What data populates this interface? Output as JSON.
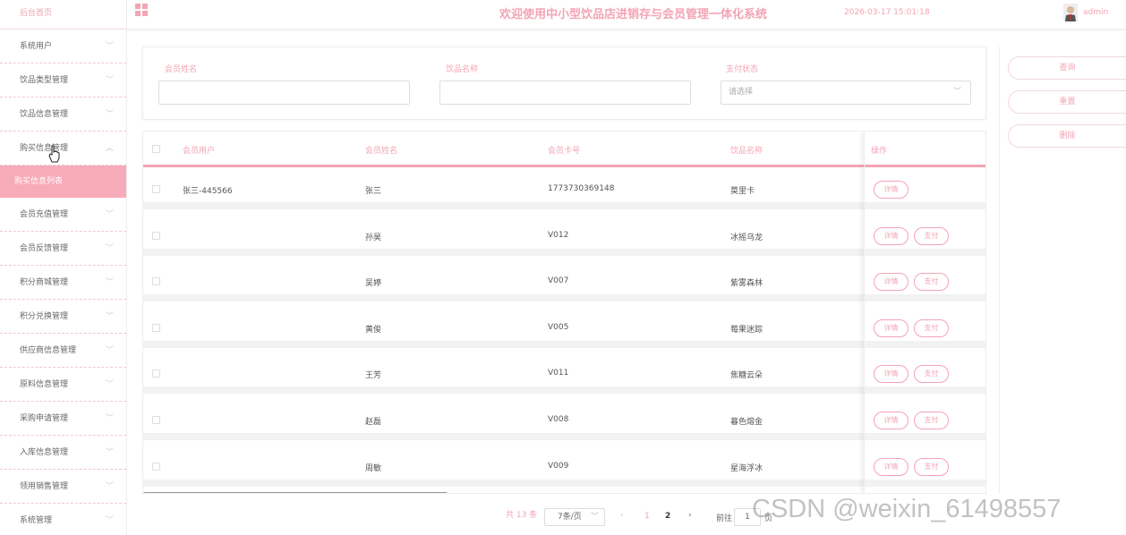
{
  "sidebar": {
    "home": "后台首页",
    "items": [
      {
        "label": "系统用户"
      },
      {
        "label": "饮品类型管理"
      },
      {
        "label": "饮品信息管理"
      },
      {
        "label": "购买信息管理"
      },
      {
        "label": "会员充值管理"
      },
      {
        "label": "会员反馈管理"
      },
      {
        "label": "积分商城管理"
      },
      {
        "label": "积分兑换管理"
      },
      {
        "label": "供应商信息管理"
      },
      {
        "label": "原料信息管理"
      },
      {
        "label": "采购申请管理"
      },
      {
        "label": "入库信息管理"
      },
      {
        "label": "领用销售管理"
      },
      {
        "label": "系统管理"
      }
    ],
    "sub_item": "购买信息列表"
  },
  "header": {
    "title": "欢迎使用中小型饮品店进销存与会员管理一体化系统",
    "time": "2026-03-17 15:01:18",
    "user": "admin"
  },
  "search": {
    "member_name_label": "会员姓名",
    "drink_name_label": "饮品名称",
    "pay_status_label": "支付状态",
    "pay_status_placeholder": "请选择"
  },
  "actions": {
    "query": "查询",
    "reset": "重置",
    "delete": "删除"
  },
  "table": {
    "headers": [
      "会员用户",
      "会员姓名",
      "会员卡号",
      "饮品名称",
      "操作"
    ],
    "rows": [
      {
        "user": "张三-445566",
        "name": "张三",
        "card": "1773730369148",
        "drink": "莫里卡",
        "pay": false
      },
      {
        "user": "",
        "name": "孙昊",
        "card": "V012",
        "drink": "冰摇乌龙",
        "pay": true
      },
      {
        "user": "",
        "name": "吴婷",
        "card": "V007",
        "drink": "紫雾森林",
        "pay": true
      },
      {
        "user": "",
        "name": "黄俊",
        "card": "V005",
        "drink": "莓果迷踪",
        "pay": true
      },
      {
        "user": "",
        "name": "王芳",
        "card": "V011",
        "drink": "焦糖云朵",
        "pay": true
      },
      {
        "user": "",
        "name": "赵磊",
        "card": "V008",
        "drink": "暮色熔金",
        "pay": true
      },
      {
        "user": "",
        "name": "周敏",
        "card": "V009",
        "drink": "星海浮冰",
        "pay": true
      }
    ],
    "detail_label": "详情",
    "pay_label": "支付"
  },
  "pagination": {
    "total": "共 13 条",
    "page_size": "7条/页",
    "pages": [
      "1",
      "2"
    ],
    "goto_prefix": "前往",
    "goto_value": "1",
    "goto_suffix": "页"
  },
  "watermark": "CSDN @weixin_61498557",
  "colors": {
    "accent": "#f3a4b5",
    "active_bg": "#f7aab8"
  }
}
